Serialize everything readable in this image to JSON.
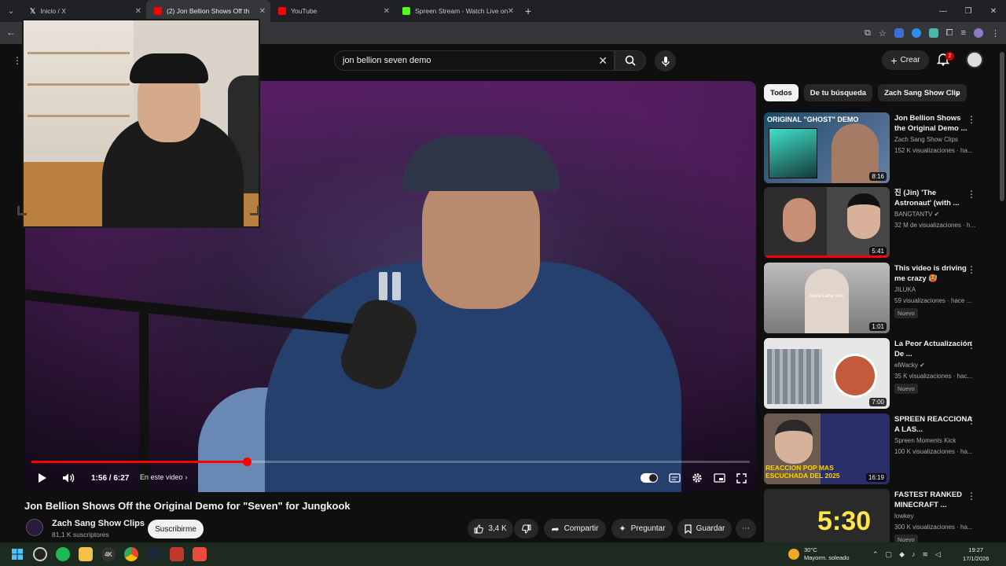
{
  "browser": {
    "tabs": [
      {
        "label": "Inicio / X",
        "color": "#ffffff"
      },
      {
        "label": "(2) Jon Bellion Shows Off th",
        "color": "#ff0000"
      },
      {
        "label": "YouTube",
        "color": "#ff0000"
      },
      {
        "label": "Spreen Stream - Watch Live on",
        "color": "#53fc18"
      }
    ]
  },
  "youtube": {
    "search": {
      "value": "jon bellion seven  demo"
    },
    "create_label": "Crear",
    "notif_count": "2",
    "player": {
      "time": "1:56 / 6:27",
      "chapter": "En este video",
      "progress": 0.3
    },
    "video_title": "Jon Bellion Shows Off the Original Demo for \"Seven\" for Jungkook",
    "channel": {
      "name": "Zach Sang Show Clips",
      "subs": "81,1 K suscriptores"
    },
    "subscribe_label": "Suscribirme",
    "actions": {
      "likes": "3,4 K",
      "share": "Compartir",
      "ask": "Preguntar",
      "save": "Guardar"
    },
    "chips": [
      "Todos",
      "De tu búsqueda",
      "Zach Sang Show Clip"
    ],
    "recommendations": [
      {
        "title": "Jon Bellion Shows the Original Demo ...",
        "channel": "Zach Sang Show Clips",
        "views": "152 K visualizaciones · ha...",
        "duration": "8:16",
        "badge": "",
        "thumb_text": "ORIGINAL \"GHOST\" DEMO",
        "color": "#2b3b52"
      },
      {
        "title": "진 (Jin) 'The Astronaut' (with ...",
        "channel": "BANGTANTV",
        "views": "32 M de visualizaciones · h...",
        "duration": "5:41",
        "badge": "",
        "thumb_text": "",
        "color": "#3a3a3a"
      },
      {
        "title": "This video is driving me crazy 🥵",
        "channel": "JILUKA",
        "views": "59 visualizaciones · hace ...",
        "duration": "1:01",
        "badge": "Nuevo",
        "thumb_text": "Mana Lana core",
        "color": "#9a9a9a"
      },
      {
        "title": "La Peor Actualización De ...",
        "channel": "elWacky",
        "views": "35 K visualizaciones · hac...",
        "duration": "7:00",
        "badge": "Nuevo",
        "thumb_text": "",
        "color": "#d6d6d6"
      },
      {
        "title": "SPREEN REACCIONA A LAS...",
        "channel": "Spreen Moments Kick",
        "views": "100 K visualizaciones · ha...",
        "duration": "16:19",
        "badge": "",
        "thumb_text": "REACCION POP MAS ESCUCHADA DEL 2025",
        "color": "#1f2a5a"
      },
      {
        "title": "FASTEST RANKED MINECRAFT ...",
        "channel": "lowkey",
        "views": "300 K visualizaciones · ha...",
        "duration": "",
        "badge": "Nuevo",
        "thumb_text": "5:30",
        "color": "#222222"
      }
    ]
  },
  "taskbar": {
    "temp": "30°C",
    "weather": "Mayorm. soleado",
    "time": "19:27",
    "date": "17/1/2026"
  }
}
